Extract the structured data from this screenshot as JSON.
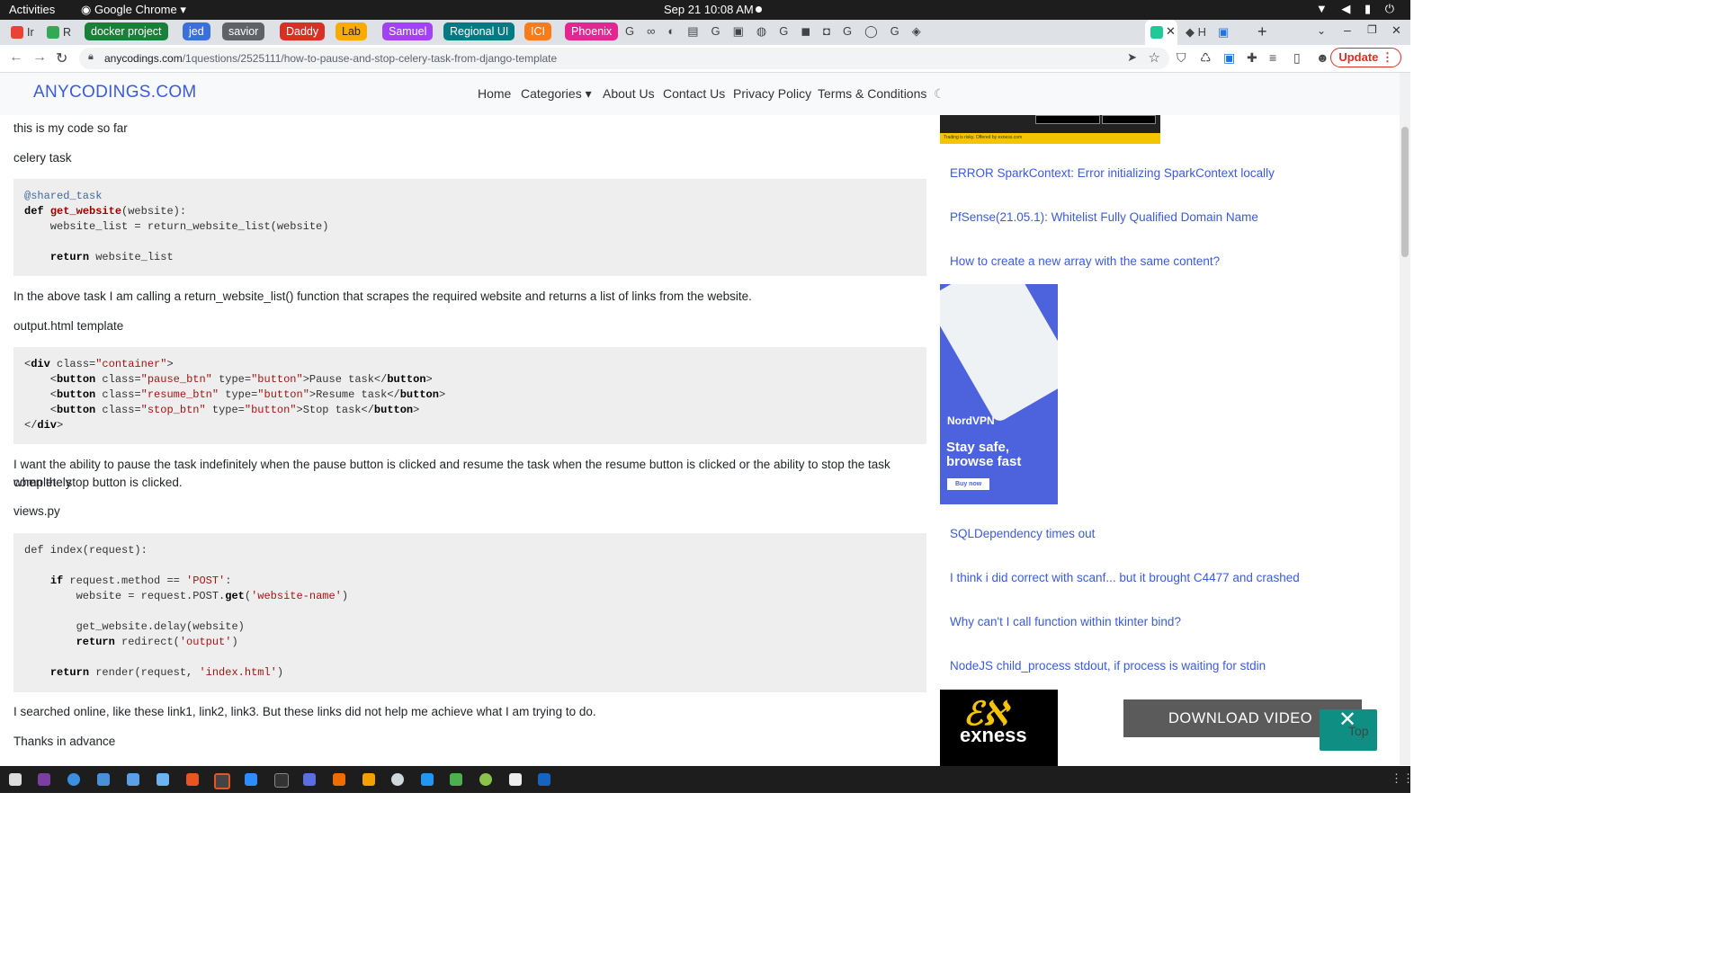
{
  "os": {
    "activities": "Activities",
    "app_name": "Google Chrome ▾",
    "clock": "Sep 21  10:08 AM"
  },
  "tabs": [
    {
      "label": "Ir",
      "color": "#ea4335"
    },
    {
      "label": "R",
      "color": "#34a853"
    },
    {
      "label": "docker project",
      "group_color": "#188038"
    },
    {
      "label": "jed",
      "group_color": "#3b6fd9"
    },
    {
      "label": "savior",
      "group_color": "#5f6368"
    },
    {
      "label": "Daddy",
      "group_color": "#d93025"
    },
    {
      "label": "Lab",
      "group_color": "#f9ab00",
      "dark_text": true
    },
    {
      "label": "Samuel",
      "group_color": "#a142f4"
    },
    {
      "label": "Regional UI",
      "group_color": "#007b83"
    },
    {
      "label": "ICI",
      "group_color": "#fa7b17"
    },
    {
      "label": "Phoenix",
      "group_color": "#e52592"
    }
  ],
  "toolbar": {
    "url_host": "anycodings.com",
    "url_path": "/1questions/2525111/how-to-pause-and-stop-celery-task-from-django-template",
    "update_label": "Update"
  },
  "site": {
    "brand": "ANYCODINGS.COM",
    "nav": [
      "Home",
      "Categories",
      "About Us",
      "Contact Us",
      "Privacy Policy",
      "Terms & Conditions"
    ]
  },
  "article": {
    "p1": "this is my code so far",
    "p2": "celery task",
    "p3": "In the above task I am calling a return_website_list() function that scrapes the required website and returns a list of links from the website.",
    "p4": "output.html template",
    "p5a": "I want the ability to pause the task indefinitely when the pause button is clicked and resume the task when the resume button is clicked or the ability to stop the task completely",
    "p5b": "when the stop button is clicked.",
    "p6": "views.py",
    "p7": "I searched online, like these link1, link2, link3. But these links did not help me achieve what I am trying to do.",
    "p8": "Thanks in advance"
  },
  "sidebar": {
    "links": [
      "ERROR SparkContext: Error initializing SparkContext locally",
      "PfSense(21.05.1): Whitelist Fully Qualified Domain Name",
      "How to create a new array with the same content?",
      "SQLDependency times out",
      "I think i did correct with scanf... but it brought C4477 and crashed",
      "Why can't I call function within tkinter bind?",
      "NodeJS child_process stdout, if process is waiting for stdin"
    ],
    "ad_top_small": "Trading is risky. Offered by exness.com",
    "nord_brand": "NordVPN",
    "nord_title_1": "Stay safe,",
    "nord_title_2": "browse fast",
    "nord_buy": "Buy now",
    "exness_word": "exness"
  },
  "overlay": {
    "download": "DOWNLOAD VIDEO",
    "top": "Top"
  }
}
